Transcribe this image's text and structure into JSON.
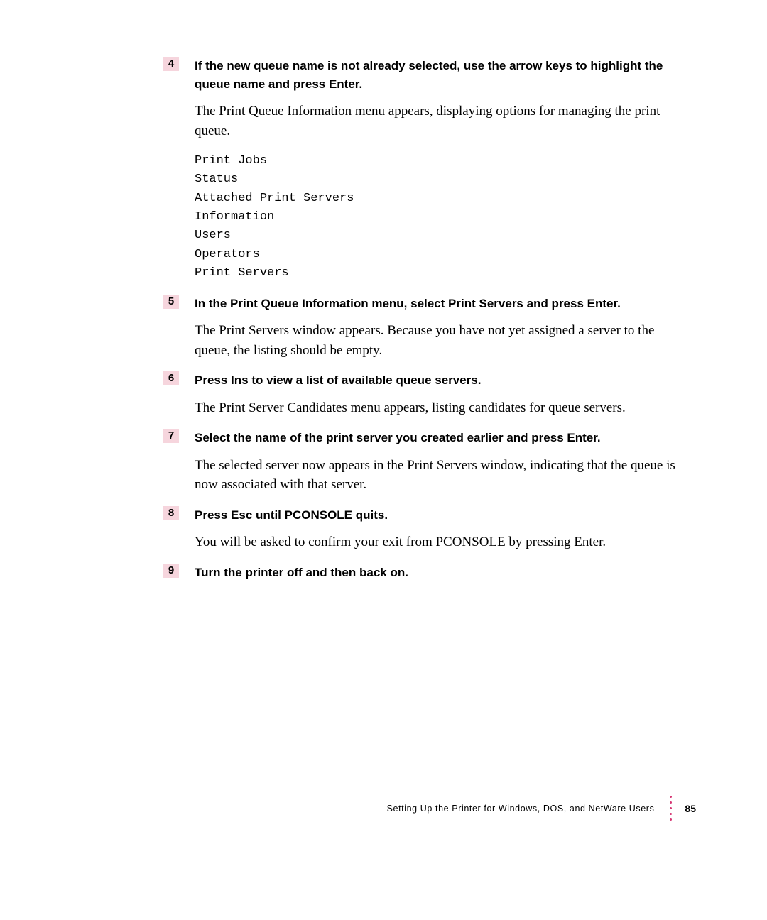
{
  "steps": {
    "s4": {
      "num": "4",
      "head": "If the new queue name is not already selected, use the arrow keys to highlight the queue name and press Enter.",
      "body": "The Print Queue Information menu appears, displaying options for managing the print queue.",
      "mono": "Print Jobs\nStatus\nAttached Print Servers\nInformation\nUsers\nOperators\nPrint Servers"
    },
    "s5": {
      "num": "5",
      "head": "In the Print Queue Information menu, select Print Servers and press Enter.",
      "body": "The Print Servers window appears. Because you have not yet assigned a server to the queue, the listing should be empty."
    },
    "s6": {
      "num": "6",
      "head": "Press Ins to view a list of available queue servers.",
      "body": "The Print Server Candidates menu appears, listing candidates for queue servers."
    },
    "s7": {
      "num": "7",
      "head": "Select the name of the print server you created earlier and press Enter.",
      "body": "The selected server now appears in the Print Servers window, indicating that the queue is now associated with that server."
    },
    "s8": {
      "num": "8",
      "head": "Press Esc until PCONSOLE quits.",
      "body": "You will be asked to confirm your exit from PCONSOLE by pressing Enter."
    },
    "s9": {
      "num": "9",
      "head": "Turn the printer off and then back on."
    }
  },
  "footer": {
    "text": "Setting Up the Printer for Windows, DOS, and NetWare Users",
    "page": "85"
  }
}
